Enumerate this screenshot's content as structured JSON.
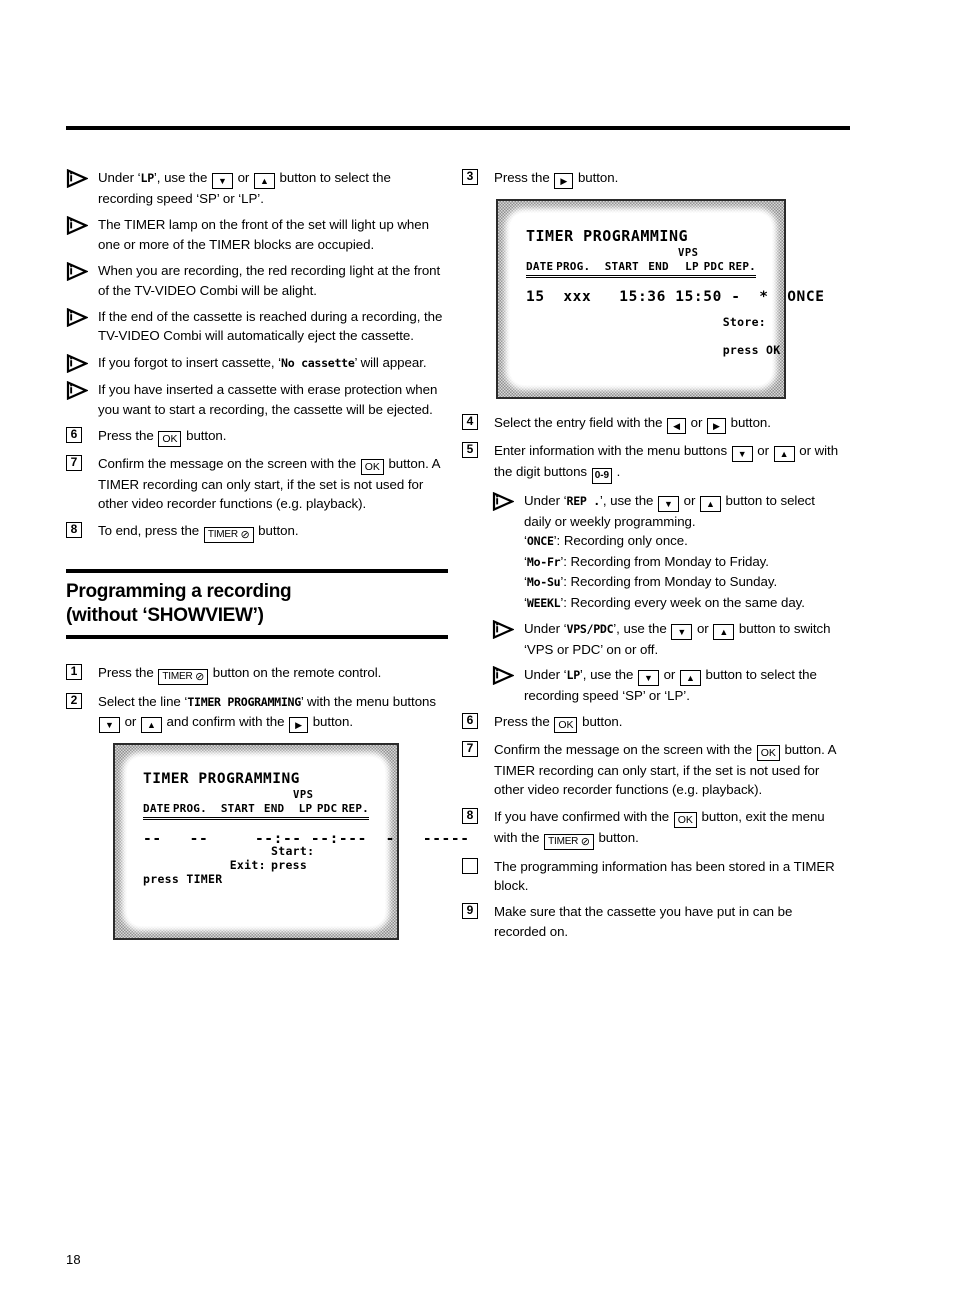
{
  "page": {
    "number": "18"
  },
  "keys": {
    "down": "▼",
    "up": "▲",
    "left": "◀",
    "right": "▶",
    "ok": "OK",
    "timer": "TIMER",
    "clock_glyph": "⊘",
    "digits": "0-9"
  },
  "left_column": {
    "notes_top": [
      {
        "marker": "info-arrow",
        "parts": [
          {
            "t": "text",
            "v": "Under ‘"
          },
          {
            "t": "mono",
            "v": "LP"
          },
          {
            "t": "text",
            "v": "’, use the "
          },
          {
            "t": "key",
            "v": "▼"
          },
          {
            "t": "text",
            "v": " or "
          },
          {
            "t": "key",
            "v": "▲"
          },
          {
            "t": "text",
            "v": " button to select the recording speed ‘SP’ or ‘LP’."
          }
        ]
      },
      {
        "marker": "info-arrow",
        "parts": [
          {
            "t": "text",
            "v": "The TIMER lamp on the front of the set will light up when one or more of the TIMER blocks are occupied."
          }
        ]
      },
      {
        "marker": "info-arrow",
        "parts": [
          {
            "t": "text",
            "v": "When you are recording, the red recording light at the front of the TV-VIDEO Combi will be alight."
          }
        ]
      },
      {
        "marker": "info-arrow",
        "parts": [
          {
            "t": "text",
            "v": "If the end of the cassette is reached during a recording, the TV-VIDEO Combi will automatically eject the cassette."
          }
        ]
      },
      {
        "marker": "info-arrow",
        "parts": [
          {
            "t": "text",
            "v": "If you forgot to insert cassette, ‘"
          },
          {
            "t": "mono",
            "v": "No cassette"
          },
          {
            "t": "text",
            "v": "’ will appear."
          }
        ]
      },
      {
        "marker": "info-arrow",
        "parts": [
          {
            "t": "text",
            "v": "If you have inserted a cassette with erase protection when you want to start a recording, the cassette will be ejected."
          }
        ]
      },
      {
        "marker": "6",
        "parts": [
          {
            "t": "text",
            "v": "Press the "
          },
          {
            "t": "key",
            "v": "OK"
          },
          {
            "t": "text",
            "v": " button."
          }
        ]
      },
      {
        "marker": "7",
        "parts": [
          {
            "t": "text",
            "v": "Confirm the message on the screen with the "
          },
          {
            "t": "key",
            "v": "OK"
          },
          {
            "t": "text",
            "v": " button. A TIMER recording can only start, if the set is not used for other video recorder functions (e.g. playback)."
          }
        ]
      },
      {
        "marker": "8",
        "parts": [
          {
            "t": "text",
            "v": "To end, press the "
          },
          {
            "t": "keytimer",
            "v": "TIMER"
          },
          {
            "t": "text",
            "v": " button."
          }
        ]
      }
    ],
    "heading": {
      "line1": "Programming a recording",
      "line2": "(without ‘SHOWVIEW’)"
    },
    "steps": [
      {
        "marker": "1",
        "parts": [
          {
            "t": "text",
            "v": "Press the "
          },
          {
            "t": "keytimer",
            "v": "TIMER"
          },
          {
            "t": "text",
            "v": " button on the remote control."
          }
        ]
      },
      {
        "marker": "2",
        "parts": [
          {
            "t": "text",
            "v": "Select the line ‘"
          },
          {
            "t": "mono",
            "v": "TIMER PROGRAMMING"
          },
          {
            "t": "text",
            "v": "’ with the menu buttons "
          },
          {
            "t": "key",
            "v": "▼"
          },
          {
            "t": "text",
            "v": " or "
          },
          {
            "t": "key",
            "v": "▲"
          },
          {
            "t": "text",
            "v": " and confirm with the "
          },
          {
            "t": "key",
            "v": "▶"
          },
          {
            "t": "text",
            "v": " button."
          }
        ]
      }
    ],
    "screen": {
      "title": "TIMER PROGRAMMING",
      "vps_label": "VPS",
      "columns": [
        "DATE",
        "PROG.",
        "START",
        "END",
        "LP",
        "PDC",
        "REP."
      ],
      "row": "--   --     --:-- --:---  -   -----",
      "footer_left_line1": "Exit:",
      "footer_left_line2": "press TIMER",
      "footer_right_line1": "Start:",
      "footer_right_line2": "press"
    }
  },
  "right_column": {
    "step3": {
      "marker": "3",
      "parts": [
        {
          "t": "text",
          "v": "Press the "
        },
        {
          "t": "key",
          "v": "▶"
        },
        {
          "t": "text",
          "v": " button."
        }
      ]
    },
    "screen": {
      "title": "TIMER PROGRAMMING",
      "vps_label": "VPS",
      "columns": [
        "DATE",
        "PROG.",
        "START",
        "END",
        "LP",
        "PDC",
        "REP."
      ],
      "row": "15  xxx   15:36 15:50 -  *  ONCE",
      "row_fields": {
        "date": "15",
        "prog": "xxx",
        "start": "15:36",
        "end": "15:50",
        "lp": "-",
        "pdc": "*",
        "rep": "ONCE"
      },
      "footer_line1": "Store:",
      "footer_line2": "press OK"
    },
    "items": [
      {
        "marker": "4",
        "parts": [
          {
            "t": "text",
            "v": "Select the entry field with the "
          },
          {
            "t": "key",
            "v": "◀"
          },
          {
            "t": "text",
            "v": " or "
          },
          {
            "t": "key",
            "v": "▶"
          },
          {
            "t": "text",
            "v": " button."
          }
        ]
      },
      {
        "marker": "5",
        "parts": [
          {
            "t": "text",
            "v": "Enter information with the menu buttons "
          },
          {
            "t": "key",
            "v": "▼"
          },
          {
            "t": "text",
            "v": " or "
          },
          {
            "t": "key",
            "v": "▲"
          },
          {
            "t": "text",
            "v": " or with the digit buttons "
          },
          {
            "t": "keydigits",
            "v": "0-9"
          },
          {
            "t": "text",
            "v": " ."
          }
        ]
      },
      {
        "marker": "info-arrow",
        "sub": true,
        "parts": [
          {
            "t": "text",
            "v": "Under ‘"
          },
          {
            "t": "mono",
            "v": "REP ."
          },
          {
            "t": "text",
            "v": "’, use the "
          },
          {
            "t": "key",
            "v": "▼"
          },
          {
            "t": "text",
            "v": " or "
          },
          {
            "t": "key",
            "v": "▲"
          },
          {
            "t": "text",
            "v": " button to select daily or weekly programming."
          },
          {
            "t": "br",
            "v": ""
          },
          {
            "t": "text",
            "v": "‘"
          },
          {
            "t": "mono",
            "v": "ONCE"
          },
          {
            "t": "text",
            "v": "’: Recording only once."
          },
          {
            "t": "br",
            "v": ""
          },
          {
            "t": "text",
            "v": "‘"
          },
          {
            "t": "mono",
            "v": "Mo-Fr"
          },
          {
            "t": "text",
            "v": "’: Recording from Monday to Friday."
          },
          {
            "t": "br",
            "v": ""
          },
          {
            "t": "text",
            "v": "‘"
          },
          {
            "t": "mono",
            "v": "Mo-Su"
          },
          {
            "t": "text",
            "v": "’: Recording from Monday to Sunday."
          },
          {
            "t": "br",
            "v": ""
          },
          {
            "t": "text",
            "v": "‘"
          },
          {
            "t": "mono",
            "v": "WEEKL"
          },
          {
            "t": "text",
            "v": "’: Recording every week on the same day."
          }
        ]
      },
      {
        "marker": "info-arrow",
        "sub": true,
        "parts": [
          {
            "t": "text",
            "v": "Under ‘"
          },
          {
            "t": "mono",
            "v": "VPS/PDC"
          },
          {
            "t": "text",
            "v": "’, use the "
          },
          {
            "t": "key",
            "v": "▼"
          },
          {
            "t": "text",
            "v": " or "
          },
          {
            "t": "key",
            "v": "▲"
          },
          {
            "t": "text",
            "v": " button to switch ‘VPS or PDC’ on or off."
          }
        ]
      },
      {
        "marker": "info-arrow",
        "sub": true,
        "parts": [
          {
            "t": "text",
            "v": "Under ‘"
          },
          {
            "t": "mono",
            "v": "LP"
          },
          {
            "t": "text",
            "v": "’, use the "
          },
          {
            "t": "key",
            "v": "▼"
          },
          {
            "t": "text",
            "v": " or "
          },
          {
            "t": "key",
            "v": "▲"
          },
          {
            "t": "text",
            "v": " button to select the recording speed ‘SP’ or ‘LP’."
          }
        ]
      },
      {
        "marker": "6",
        "parts": [
          {
            "t": "text",
            "v": "Press the "
          },
          {
            "t": "key",
            "v": "OK"
          },
          {
            "t": "text",
            "v": " button."
          }
        ]
      },
      {
        "marker": "7",
        "parts": [
          {
            "t": "text",
            "v": "Confirm the message on the screen with the "
          },
          {
            "t": "key",
            "v": "OK"
          },
          {
            "t": "text",
            "v": " button. A TIMER recording can only start, if the set is not used for other video recorder functions (e.g. playback)."
          }
        ]
      },
      {
        "marker": "8",
        "parts": [
          {
            "t": "text",
            "v": "If you have confirmed with the "
          },
          {
            "t": "key",
            "v": "OK"
          },
          {
            "t": "text",
            "v": " button, exit the menu with the "
          },
          {
            "t": "keytimer",
            "v": "TIMER"
          },
          {
            "t": "text",
            "v": " button."
          }
        ]
      },
      {
        "marker": "empty-box",
        "parts": [
          {
            "t": "text",
            "v": "The programming information has been stored in a TIMER block."
          }
        ]
      },
      {
        "marker": "9",
        "parts": [
          {
            "t": "text",
            "v": "Make sure that the cassette you have put in can be recorded on."
          }
        ]
      }
    ]
  }
}
